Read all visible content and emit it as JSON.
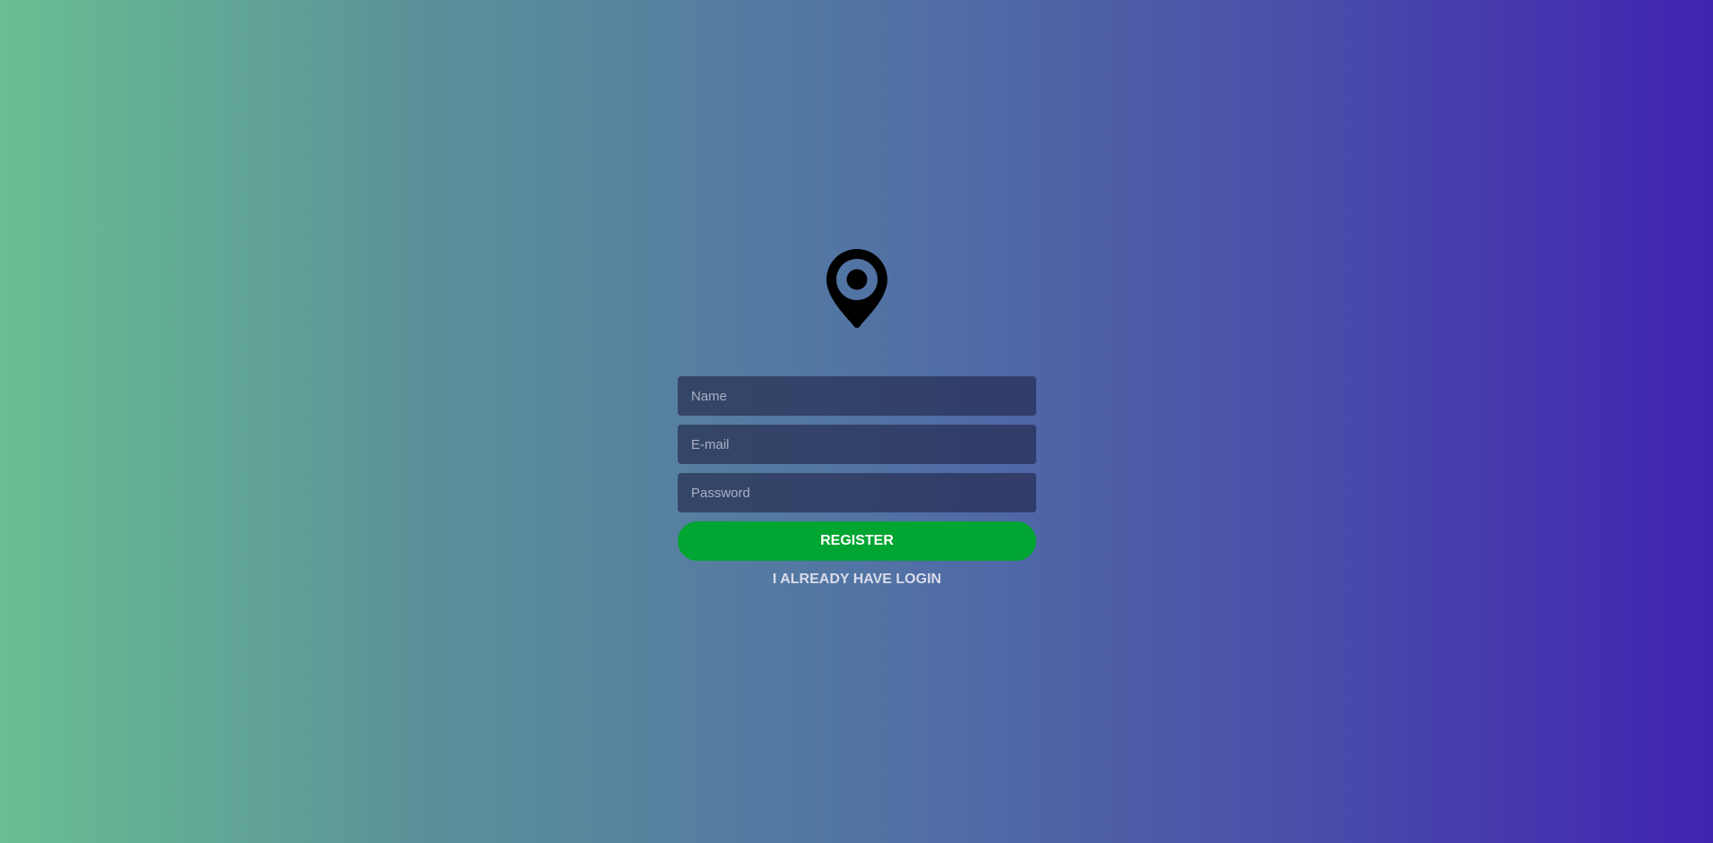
{
  "logo": {
    "icon": "map-pin-icon",
    "color": "#000000"
  },
  "form": {
    "name_placeholder": "Name",
    "email_placeholder": "E-mail",
    "password_placeholder": "Password",
    "register_label": "REGISTER",
    "login_link_label": "I ALREADY HAVE LOGIN"
  },
  "colors": {
    "gradient_start": "#68be92",
    "gradient_end": "#4123b1",
    "field_background": "#2b3a5b",
    "register_button": "#00a532"
  }
}
